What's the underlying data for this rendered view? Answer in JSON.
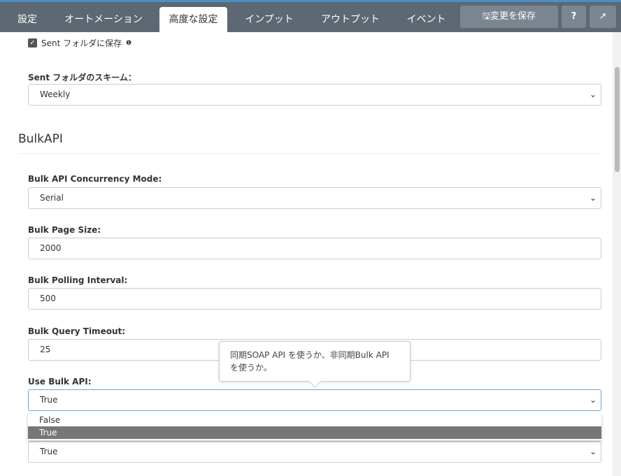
{
  "tabs": [
    {
      "label": "設定"
    },
    {
      "label": "オートメーション"
    },
    {
      "label": "高度な設定"
    },
    {
      "label": "インプット"
    },
    {
      "label": "アウトプット"
    },
    {
      "label": "イベント"
    }
  ],
  "toolbar": {
    "save_label": "変更を保存",
    "help_icon": "?",
    "external_icon": "↗"
  },
  "sent_checkbox": {
    "label": "Sent フォルダに保存",
    "checked": true,
    "info": "❶"
  },
  "sent_scheme": {
    "label": "Sent フォルダのスキーム：",
    "value": "Weekly"
  },
  "section_title": "BulkAPI",
  "concurrency": {
    "label": "Bulk API Concurrency Mode:",
    "value": "Serial"
  },
  "page_size": {
    "label": "Bulk Page Size:",
    "value": "2000"
  },
  "polling": {
    "label": "Bulk Polling Interval:",
    "value": "500"
  },
  "timeout": {
    "label": "Bulk Query Timeout:",
    "value": "25"
  },
  "use_bulk": {
    "label": "Use Bulk API:",
    "value": "True",
    "options": [
      "False",
      "True"
    ],
    "tooltip": "同期SOAP API を使うか、非同期Bulk API を使うか。"
  },
  "next_select": {
    "value": "True"
  }
}
